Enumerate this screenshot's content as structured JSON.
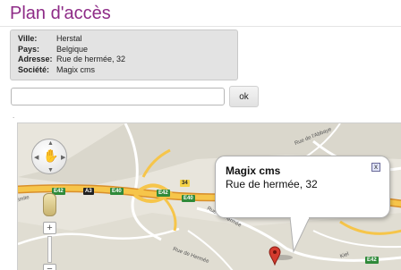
{
  "page": {
    "title": "Plan d'accès"
  },
  "info": {
    "rows": [
      {
        "label": "Ville:",
        "value": "Herstal"
      },
      {
        "label": "Pays:",
        "value": "Belgique"
      },
      {
        "label": "Adresse:",
        "value": "Rue de hermée, 32"
      },
      {
        "label": "Société:",
        "value": "Magix cms"
      }
    ]
  },
  "search": {
    "value": "",
    "placeholder": "",
    "button_label": "ok"
  },
  "separator": ".",
  "map": {
    "popup": {
      "name": "Magix cms",
      "address": "Rue de hermée, 32",
      "close_label": "x"
    },
    "shields": [
      "E42",
      "A3",
      "E40",
      "E42",
      "34",
      "E40",
      "E42"
    ],
    "road_labels": [
      "Rue de l'Abbaye",
      "Rue de Hermée",
      "Limite",
      "Rue de Hermée",
      "Kiel"
    ],
    "controls": {
      "zoom_in": "+",
      "zoom_out": "−"
    },
    "marker_color": "#d43b2e"
  }
}
